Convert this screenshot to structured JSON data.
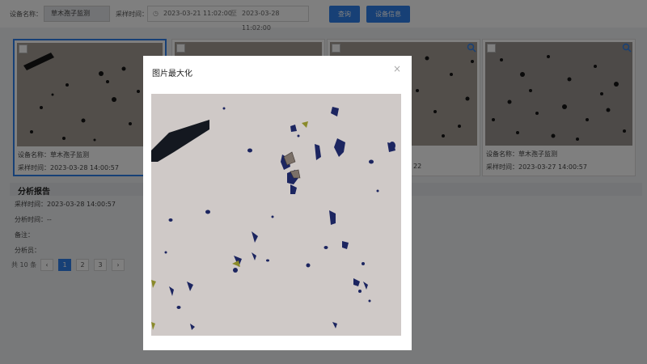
{
  "toolbar": {
    "device_label": "设备名称：",
    "device_value": "草木孢子监测",
    "time_label": "采样时间：",
    "start_date": "2023-03-21 11:02:00",
    "range_sep": "至",
    "end_date": "2023-03-28 11:02:00",
    "search_btn": "查询",
    "info_btn": "设备信息"
  },
  "cards": [
    {
      "device": "设备名称：草木孢子监测",
      "time": "采样时间：2023-03-28 14:00:57"
    },
    {
      "device": "",
      "time": ""
    },
    {
      "device": "",
      "time": "22"
    },
    {
      "device": "设备名称：草木孢子监测",
      "time": "采样时间：2023-03-27 14:00:57"
    }
  ],
  "report": {
    "title": "分析报告",
    "sample_time": "采样时间：2023-03-28 14:00:57",
    "analysis_time": "分析时间：--",
    "remark": "备注：",
    "analyst": "分析员："
  },
  "pager": {
    "total": "共 10 条",
    "prev": "‹",
    "pages": [
      "1",
      "2",
      "3"
    ],
    "next": "›"
  },
  "modal": {
    "title": "图片最大化",
    "close": "×"
  },
  "colors": {
    "accent": "#2f80ed",
    "particle": "#1a1f4a",
    "sample_bg": "#cfc9c7"
  }
}
